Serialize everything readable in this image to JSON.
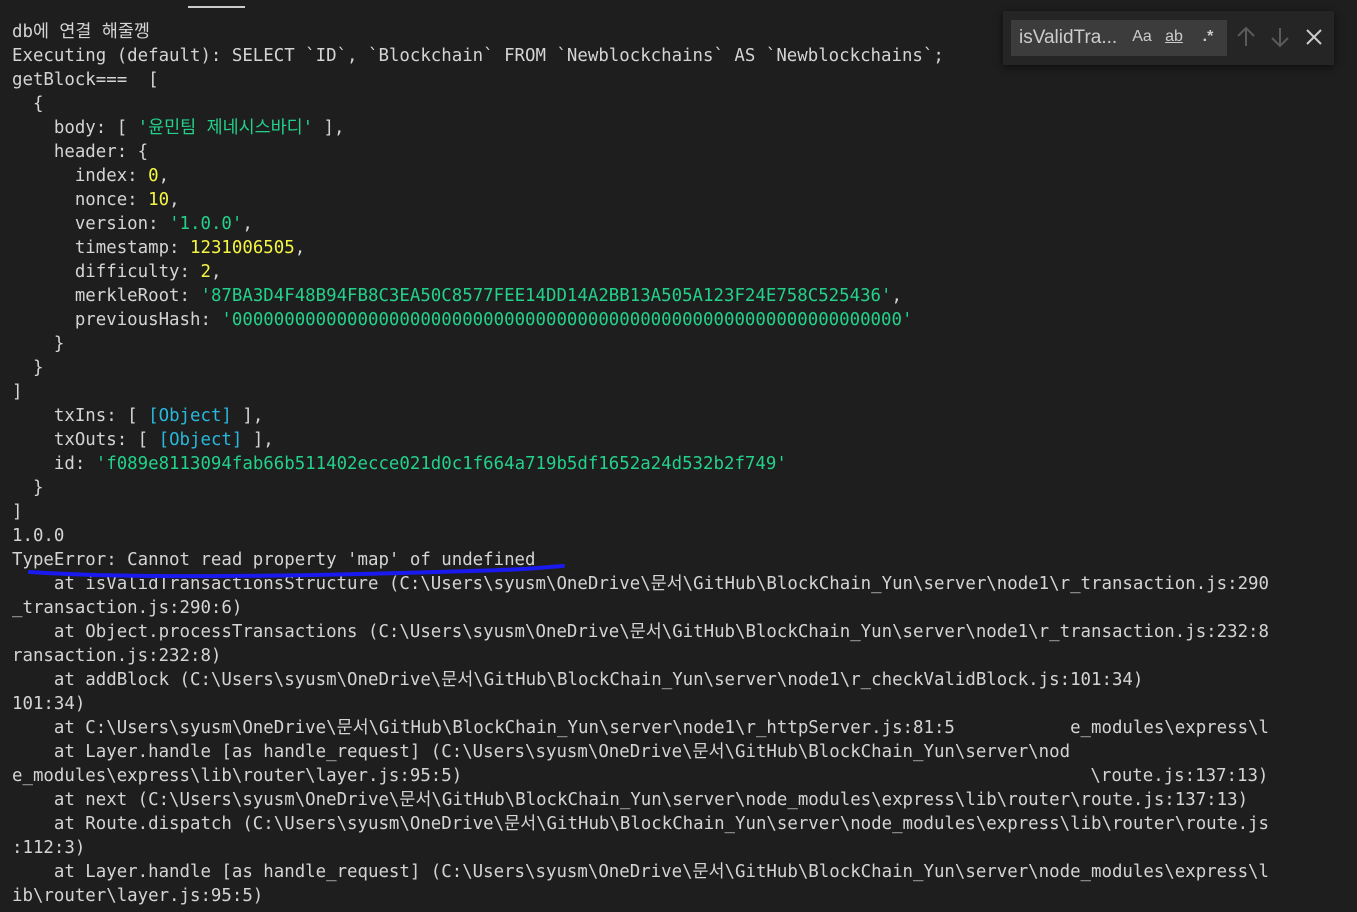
{
  "terminal": {
    "lines": [
      [
        {
          "t": "db에 연결 해줄껭"
        }
      ],
      [
        {
          "t": "Executing (default): SELECT `ID`, `Blockchain` FROM `Newblockchains` AS `Newblockchains`;"
        }
      ],
      [
        {
          "t": "getBlock===  ["
        }
      ],
      [
        {
          "t": "  {"
        }
      ],
      [
        {
          "t": "    body: [ "
        },
        {
          "t": "'윤민팀 제네시스바디'",
          "c": "str"
        },
        {
          "t": " ],"
        }
      ],
      [
        {
          "t": "    header: {"
        }
      ],
      [
        {
          "t": "      index: "
        },
        {
          "t": "0",
          "c": "num"
        },
        {
          "t": ","
        }
      ],
      [
        {
          "t": "      nonce: "
        },
        {
          "t": "10",
          "c": "num"
        },
        {
          "t": ","
        }
      ],
      [
        {
          "t": "      version: "
        },
        {
          "t": "'1.0.0'",
          "c": "str"
        },
        {
          "t": ","
        }
      ],
      [
        {
          "t": "      timestamp: "
        },
        {
          "t": "1231006505",
          "c": "num"
        },
        {
          "t": ","
        }
      ],
      [
        {
          "t": "      difficulty: "
        },
        {
          "t": "2",
          "c": "num"
        },
        {
          "t": ","
        }
      ],
      [
        {
          "t": "      merkleRoot: "
        },
        {
          "t": "'87BA3D4F48B94FB8C3EA50C8577FEE14DD14A2BB13A505A123F24E758C525436'",
          "c": "str"
        },
        {
          "t": ","
        }
      ],
      [
        {
          "t": "      previousHash: "
        },
        {
          "t": "'0000000000000000000000000000000000000000000000000000000000000000'",
          "c": "str"
        }
      ],
      [
        {
          "t": "    }"
        }
      ],
      [
        {
          "t": "  }"
        }
      ],
      [
        {
          "t": "]"
        }
      ],
      [
        {
          "t": "    txIns: [ "
        },
        {
          "t": "[Object]",
          "c": "obj"
        },
        {
          "t": " ],"
        }
      ],
      [
        {
          "t": "    txOuts: [ "
        },
        {
          "t": "[Object]",
          "c": "obj"
        },
        {
          "t": " ],"
        }
      ],
      [
        {
          "t": "    id: "
        },
        {
          "t": "'f089e8113094fab66b511402ecce021d0c1f664a719b5df1652a24d532b2f749'",
          "c": "str"
        }
      ],
      [
        {
          "t": "  }"
        }
      ],
      [
        {
          "t": "]"
        }
      ],
      [
        {
          "t": "1.0.0"
        }
      ],
      [
        {
          "t": "TypeError: Cannot read property 'map' of undefined"
        }
      ],
      [
        {
          "t": "    at isValidTransactionsStructure (C:\\Users\\syusm\\OneDrive\\문서\\GitHub\\BlockChain_Yun\\server\\node1\\r_transaction.js:290"
        }
      ],
      [
        {
          "t": "_transaction.js:290:6)"
        }
      ],
      [
        {
          "t": "    at Object.processTransactions (C:\\Users\\syusm\\OneDrive\\문서\\GitHub\\BlockChain_Yun\\server\\node1\\r_transaction.js:232:8"
        }
      ],
      [
        {
          "t": "ransaction.js:232:8)"
        }
      ],
      [
        {
          "t": "    at addBlock (C:\\Users\\syusm\\OneDrive\\문서\\GitHub\\BlockChain_Yun\\server\\node1\\r_checkValidBlock.js:101:34)"
        }
      ],
      [
        {
          "t": "101:34)"
        }
      ],
      [
        {
          "t": "    at C:\\Users\\syusm\\OneDrive\\문서\\GitHub\\BlockChain_Yun\\server\\node1\\r_httpServer.js:81:5           e_modules\\express\\l"
        }
      ],
      [
        {
          "t": "    at Layer.handle [as handle_request] (C:\\Users\\syusm\\OneDrive\\문서\\GitHub\\BlockChain_Yun\\server\\nod"
        }
      ],
      [
        {
          "t": "e_modules\\express\\lib\\router\\layer.js:95:5)                                                            \\route.js:137:13)"
        }
      ],
      [
        {
          "t": "    at next (C:\\Users\\syusm\\OneDrive\\문서\\GitHub\\BlockChain_Yun\\server\\node_modules\\express\\lib\\router\\route.js:137:13)"
        }
      ],
      [
        {
          "t": "    at Route.dispatch (C:\\Users\\syusm\\OneDrive\\문서\\GitHub\\BlockChain_Yun\\server\\node_modules\\express\\lib\\router\\route.js"
        }
      ],
      [
        {
          "t": ":112:3)"
        }
      ],
      [
        {
          "t": "    at Layer.handle [as handle_request] (C:\\Users\\syusm\\OneDrive\\문서\\GitHub\\BlockChain_Yun\\server\\node_modules\\express\\l"
        }
      ],
      [
        {
          "t": "ib\\router\\layer.js:95:5)"
        }
      ]
    ]
  },
  "find_widget": {
    "query": "isValidTra...",
    "match_case": "Aa",
    "whole_word": "ab",
    "regex": ".*"
  },
  "colors": {
    "background": "#1e1e1e",
    "text": "#d4d4d4",
    "string": "#23d18b",
    "number": "#f5f543",
    "object": "#29b8db",
    "annotation": "#1a1af0"
  }
}
